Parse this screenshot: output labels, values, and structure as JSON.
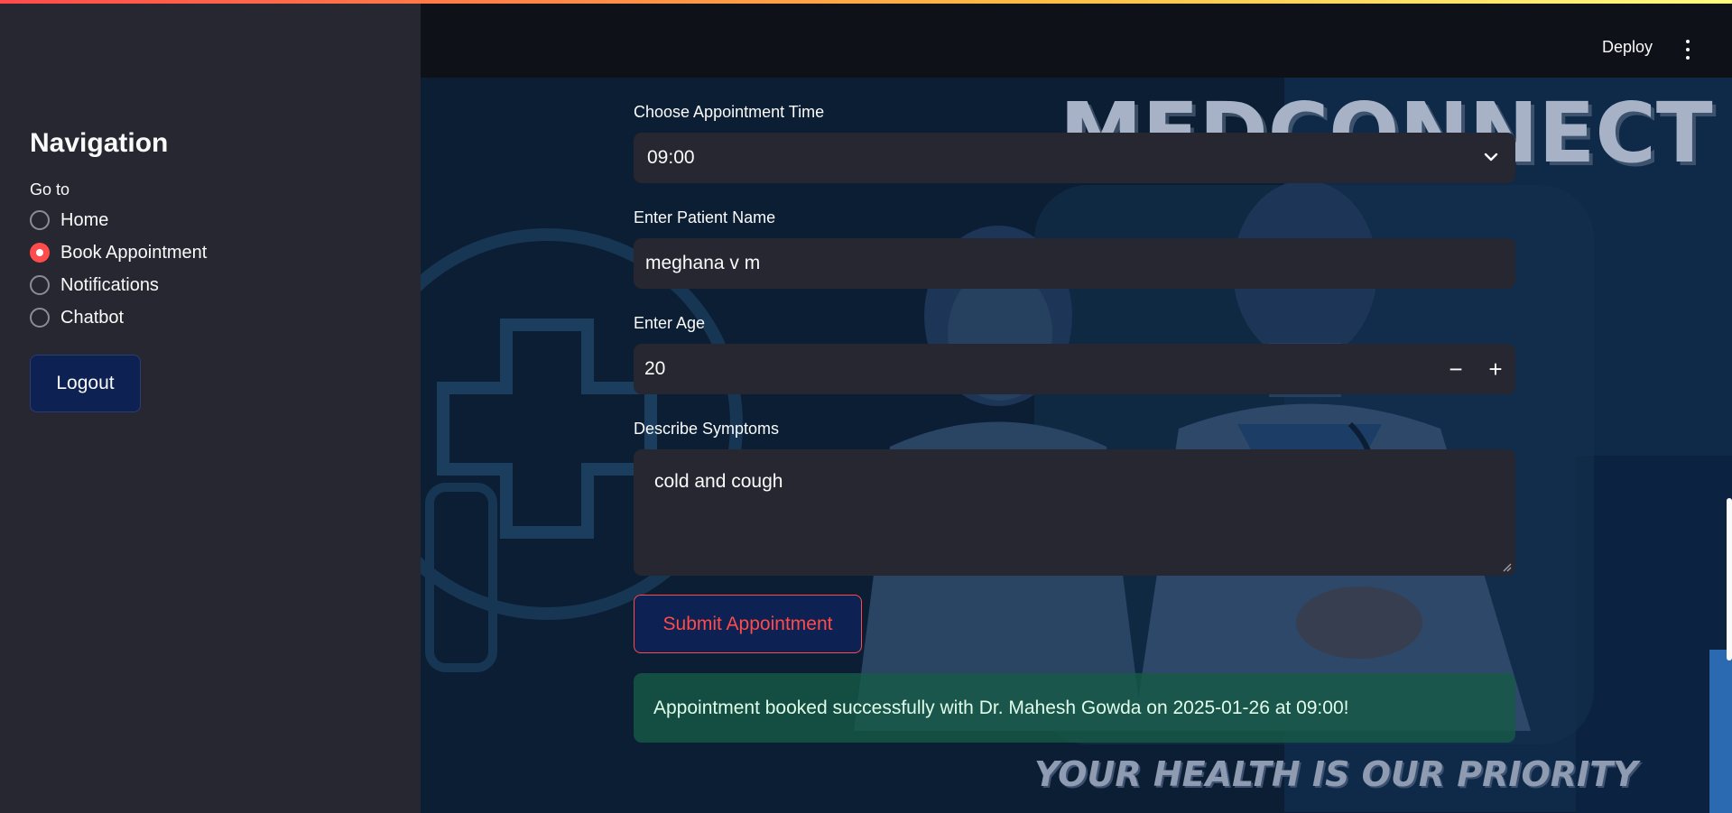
{
  "sidebar": {
    "title": "Navigation",
    "radio_label": "Go to",
    "options": [
      {
        "label": "Home",
        "selected": false
      },
      {
        "label": "Book Appointment",
        "selected": true
      },
      {
        "label": "Notifications",
        "selected": false
      },
      {
        "label": "Chatbot",
        "selected": false
      }
    ],
    "logout_label": "Logout"
  },
  "header": {
    "deploy_label": "Deploy",
    "menu_icon": "kebab-menu-icon"
  },
  "background": {
    "brand_text": "MEDCONNECT",
    "tagline": "YOUR HEALTH IS OUR PRIORITY"
  },
  "form": {
    "time": {
      "label": "Choose Appointment Time",
      "value": "09:00"
    },
    "name": {
      "label": "Enter Patient Name",
      "value": "meghana v m"
    },
    "age": {
      "label": "Enter Age",
      "value": "20",
      "minus": "−",
      "plus": "+"
    },
    "symptoms": {
      "label": "Describe Symptoms",
      "value": "cold and cough"
    },
    "submit_label": "Submit Appointment"
  },
  "status": {
    "message": "Appointment booked successfully with Dr. Mahesh Gowda on 2025-01-26 at 09:00!"
  },
  "colors": {
    "primary": "#ff4b4b",
    "sidebar_bg": "#262730",
    "header_bg": "#0e1117",
    "button_navy": "#0d2152",
    "success_bg": "#165a46"
  }
}
